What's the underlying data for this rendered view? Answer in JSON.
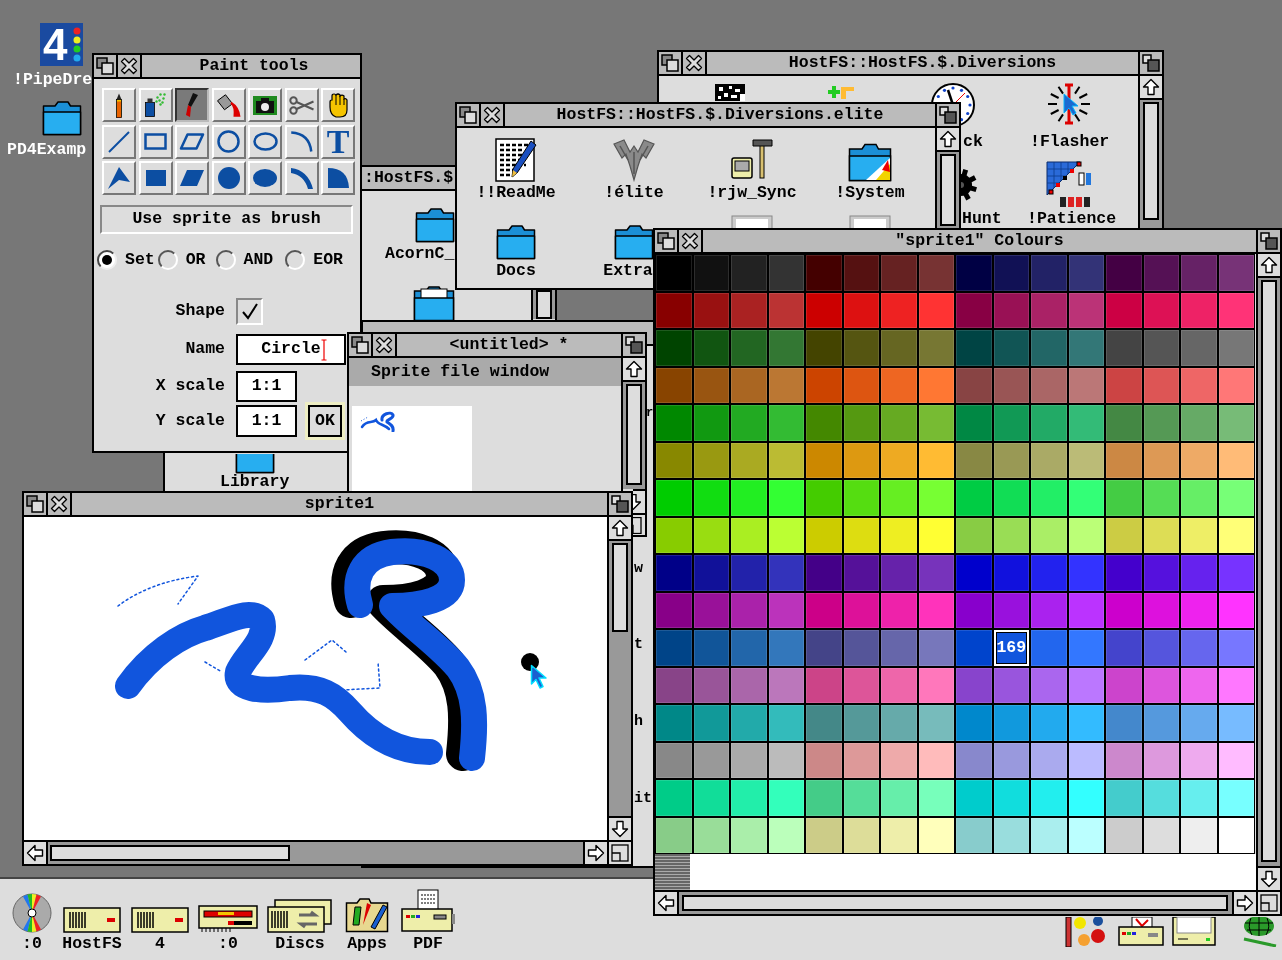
{
  "desktop_icons": [
    {
      "kind": "logo",
      "logo_text": "4",
      "label": "!PipeDre"
    },
    {
      "kind": "folder",
      "label": "PD4Examp"
    }
  ],
  "diversions_window": {
    "title": "HostFS::HostFS.$.Diversions",
    "items": [
      {
        "kind": "chequered"
      },
      {
        "kind": "blocks"
      },
      {
        "kind": "clock",
        "label": "ck"
      },
      {
        "kind": "flasher",
        "label": "!Flasher"
      },
      {
        "kind": "gear",
        "label": "Hunt"
      },
      {
        "kind": "patience",
        "label": "!Patience"
      }
    ]
  },
  "hostfs_window": {
    "title": ":HostFS.$",
    "items": [
      {
        "kind": "folder",
        "label": "AcornC_"
      },
      {
        "kind": "folder_doc"
      },
      {
        "kind": "folder",
        "label": "Library"
      }
    ]
  },
  "elite_window": {
    "title": "HostFS::HostFS.$.Diversions.elite",
    "items": [
      {
        "kind": "readme",
        "label": "!!ReadMe"
      },
      {
        "kind": "elite",
        "label": "!élite"
      },
      {
        "kind": "sync",
        "label": "!rjw_Sync"
      },
      {
        "kind": "system",
        "label": "!System"
      },
      {
        "kind": "folder",
        "label": "Docs"
      },
      {
        "kind": "folder",
        "label": "Extra"
      },
      {
        "kind": "file"
      },
      {
        "kind": "file"
      }
    ]
  },
  "paint_tools": {
    "title": "Paint tools",
    "tools": [
      {
        "kind": "pencil",
        "selected": false
      },
      {
        "kind": "spray",
        "selected": false
      },
      {
        "kind": "brush",
        "selected": true
      },
      {
        "kind": "fill",
        "selected": false
      },
      {
        "kind": "camera",
        "selected": false
      },
      {
        "kind": "scissors",
        "selected": false
      },
      {
        "kind": "hand",
        "selected": false
      },
      {
        "kind": "line",
        "selected": false
      },
      {
        "kind": "rectangle",
        "selected": false
      },
      {
        "kind": "parallelogram",
        "selected": false
      },
      {
        "kind": "circle",
        "selected": false
      },
      {
        "kind": "ellipse",
        "selected": false
      },
      {
        "kind": "arc",
        "selected": false
      },
      {
        "kind": "text",
        "glyph": "T",
        "selected": false
      },
      {
        "kind": "polygon",
        "selected": false
      },
      {
        "kind": "filled_rectangle",
        "selected": false
      },
      {
        "kind": "filled_parallelogram",
        "selected": false
      },
      {
        "kind": "filled_circle",
        "selected": false
      },
      {
        "kind": "filled_ellipse",
        "selected": false
      },
      {
        "kind": "segment",
        "selected": false
      },
      {
        "kind": "sector",
        "selected": false
      }
    ],
    "brush_label": "Use sprite as brush",
    "modes": [
      {
        "label": "Set",
        "selected": true
      },
      {
        "label": "OR",
        "selected": false
      },
      {
        "label": "AND",
        "selected": false
      },
      {
        "label": "EOR",
        "selected": false
      }
    ],
    "shape": {
      "label": "Shape",
      "checked": true
    },
    "fields": [
      {
        "label": "Name",
        "value": "Circle",
        "focused": true
      },
      {
        "label": "X scale",
        "value": "1:1",
        "focused": false
      },
      {
        "label": "Y scale",
        "value": "1:1",
        "focused": false
      }
    ],
    "ok_button": "OK"
  },
  "resources_window": {
    "icon_labels": [
      "r",
      "w",
      "t",
      "h",
      "it"
    ]
  },
  "untitled_window": {
    "title": "<untitled> *",
    "info_bar": "Sprite file window"
  },
  "sprite_window": {
    "title": "sprite1"
  },
  "colours_window": {
    "title": "\"sprite1\" Colours",
    "cells": [
      {
        "color": "#000000",
        "selected": false
      },
      {
        "color": "#111111",
        "selected": false
      },
      {
        "color": "#222222",
        "selected": false
      },
      {
        "color": "#333333",
        "selected": false
      },
      {
        "color": "#440000",
        "selected": false
      },
      {
        "color": "#551111",
        "selected": false
      },
      {
        "color": "#662222",
        "selected": false
      },
      {
        "color": "#773333",
        "selected": false
      },
      {
        "color": "#000044",
        "selected": false
      },
      {
        "color": "#111155",
        "selected": false
      },
      {
        "color": "#222266",
        "selected": false
      },
      {
        "color": "#333377",
        "selected": false
      },
      {
        "color": "#440044",
        "selected": false
      },
      {
        "color": "#551155",
        "selected": false
      },
      {
        "color": "#662266",
        "selected": false
      },
      {
        "color": "#773377",
        "selected": false
      },
      {
        "color": "#880000",
        "selected": false
      },
      {
        "color": "#991111",
        "selected": false
      },
      {
        "color": "#aa2222",
        "selected": false
      },
      {
        "color": "#bb3333",
        "selected": false
      },
      {
        "color": "#cc0000",
        "selected": false
      },
      {
        "color": "#dd1111",
        "selected": false
      },
      {
        "color": "#ee2222",
        "selected": false
      },
      {
        "color": "#ff3333",
        "selected": false
      },
      {
        "color": "#880044",
        "selected": false
      },
      {
        "color": "#991155",
        "selected": false
      },
      {
        "color": "#aa2266",
        "selected": false
      },
      {
        "color": "#bb3377",
        "selected": false
      },
      {
        "color": "#cc0044",
        "selected": false
      },
      {
        "color": "#dd1155",
        "selected": false
      },
      {
        "color": "#ee2266",
        "selected": false
      },
      {
        "color": "#ff3377",
        "selected": false
      },
      {
        "color": "#004400",
        "selected": false
      },
      {
        "color": "#115511",
        "selected": false
      },
      {
        "color": "#226622",
        "selected": false
      },
      {
        "color": "#337733",
        "selected": false
      },
      {
        "color": "#444400",
        "selected": false
      },
      {
        "color": "#555511",
        "selected": false
      },
      {
        "color": "#666622",
        "selected": false
      },
      {
        "color": "#777733",
        "selected": false
      },
      {
        "color": "#004444",
        "selected": false
      },
      {
        "color": "#115555",
        "selected": false
      },
      {
        "color": "#226666",
        "selected": false
      },
      {
        "color": "#337777",
        "selected": false
      },
      {
        "color": "#444444",
        "selected": false
      },
      {
        "color": "#555555",
        "selected": false
      },
      {
        "color": "#666666",
        "selected": false
      },
      {
        "color": "#777777",
        "selected": false
      },
      {
        "color": "#884400",
        "selected": false
      },
      {
        "color": "#995511",
        "selected": false
      },
      {
        "color": "#aa6622",
        "selected": false
      },
      {
        "color": "#bb7733",
        "selected": false
      },
      {
        "color": "#cc4400",
        "selected": false
      },
      {
        "color": "#dd5511",
        "selected": false
      },
      {
        "color": "#ee6622",
        "selected": false
      },
      {
        "color": "#ff7733",
        "selected": false
      },
      {
        "color": "#884444",
        "selected": false
      },
      {
        "color": "#995555",
        "selected": false
      },
      {
        "color": "#aa6666",
        "selected": false
      },
      {
        "color": "#bb7777",
        "selected": false
      },
      {
        "color": "#cc4444",
        "selected": false
      },
      {
        "color": "#dd5555",
        "selected": false
      },
      {
        "color": "#ee6666",
        "selected": false
      },
      {
        "color": "#ff7777",
        "selected": false
      },
      {
        "color": "#008800",
        "selected": false
      },
      {
        "color": "#119911",
        "selected": false
      },
      {
        "color": "#22aa22",
        "selected": false
      },
      {
        "color": "#33bb33",
        "selected": false
      },
      {
        "color": "#448800",
        "selected": false
      },
      {
        "color": "#559911",
        "selected": false
      },
      {
        "color": "#66aa22",
        "selected": false
      },
      {
        "color": "#77bb33",
        "selected": false
      },
      {
        "color": "#008844",
        "selected": false
      },
      {
        "color": "#119955",
        "selected": false
      },
      {
        "color": "#22aa66",
        "selected": false
      },
      {
        "color": "#33bb77",
        "selected": false
      },
      {
        "color": "#448844",
        "selected": false
      },
      {
        "color": "#559955",
        "selected": false
      },
      {
        "color": "#66aa66",
        "selected": false
      },
      {
        "color": "#77bb77",
        "selected": false
      },
      {
        "color": "#888800",
        "selected": false
      },
      {
        "color": "#999911",
        "selected": false
      },
      {
        "color": "#aaaa22",
        "selected": false
      },
      {
        "color": "#bbbb33",
        "selected": false
      },
      {
        "color": "#cc8800",
        "selected": false
      },
      {
        "color": "#dd9911",
        "selected": false
      },
      {
        "color": "#eeaa22",
        "selected": false
      },
      {
        "color": "#ffbb33",
        "selected": false
      },
      {
        "color": "#888844",
        "selected": false
      },
      {
        "color": "#999955",
        "selected": false
      },
      {
        "color": "#aaaa66",
        "selected": false
      },
      {
        "color": "#bbbb77",
        "selected": false
      },
      {
        "color": "#cc8844",
        "selected": false
      },
      {
        "color": "#dd9955",
        "selected": false
      },
      {
        "color": "#eeaa66",
        "selected": false
      },
      {
        "color": "#ffbb77",
        "selected": false
      },
      {
        "color": "#00cc00",
        "selected": false
      },
      {
        "color": "#11dd11",
        "selected": false
      },
      {
        "color": "#22ee22",
        "selected": false
      },
      {
        "color": "#33ff33",
        "selected": false
      },
      {
        "color": "#44cc00",
        "selected": false
      },
      {
        "color": "#55dd11",
        "selected": false
      },
      {
        "color": "#66ee22",
        "selected": false
      },
      {
        "color": "#77ff33",
        "selected": false
      },
      {
        "color": "#00cc44",
        "selected": false
      },
      {
        "color": "#11dd55",
        "selected": false
      },
      {
        "color": "#22ee66",
        "selected": false
      },
      {
        "color": "#33ff77",
        "selected": false
      },
      {
        "color": "#44cc44",
        "selected": false
      },
      {
        "color": "#55dd55",
        "selected": false
      },
      {
        "color": "#66ee66",
        "selected": false
      },
      {
        "color": "#77ff77",
        "selected": false
      },
      {
        "color": "#88cc00",
        "selected": false
      },
      {
        "color": "#99dd11",
        "selected": false
      },
      {
        "color": "#aaee22",
        "selected": false
      },
      {
        "color": "#bbff33",
        "selected": false
      },
      {
        "color": "#cccc00",
        "selected": false
      },
      {
        "color": "#dddd11",
        "selected": false
      },
      {
        "color": "#eeee22",
        "selected": false
      },
      {
        "color": "#ffff33",
        "selected": false
      },
      {
        "color": "#88cc44",
        "selected": false
      },
      {
        "color": "#99dd55",
        "selected": false
      },
      {
        "color": "#aaee66",
        "selected": false
      },
      {
        "color": "#bbff77",
        "selected": false
      },
      {
        "color": "#cccc44",
        "selected": false
      },
      {
        "color": "#dddd55",
        "selected": false
      },
      {
        "color": "#eeee66",
        "selected": false
      },
      {
        "color": "#ffff77",
        "selected": false
      },
      {
        "color": "#000088",
        "selected": false
      },
      {
        "color": "#111199",
        "selected": false
      },
      {
        "color": "#2222aa",
        "selected": false
      },
      {
        "color": "#3333bb",
        "selected": false
      },
      {
        "color": "#440088",
        "selected": false
      },
      {
        "color": "#551199",
        "selected": false
      },
      {
        "color": "#6622aa",
        "selected": false
      },
      {
        "color": "#7733bb",
        "selected": false
      },
      {
        "color": "#0000cc",
        "selected": false
      },
      {
        "color": "#1111dd",
        "selected": false
      },
      {
        "color": "#2222ee",
        "selected": false
      },
      {
        "color": "#3333ff",
        "selected": false
      },
      {
        "color": "#4400cc",
        "selected": false
      },
      {
        "color": "#5511dd",
        "selected": false
      },
      {
        "color": "#6622ee",
        "selected": false
      },
      {
        "color": "#7733ff",
        "selected": false
      },
      {
        "color": "#880088",
        "selected": false
      },
      {
        "color": "#991199",
        "selected": false
      },
      {
        "color": "#aa22aa",
        "selected": false
      },
      {
        "color": "#bb33bb",
        "selected": false
      },
      {
        "color": "#cc0088",
        "selected": false
      },
      {
        "color": "#dd1199",
        "selected": false
      },
      {
        "color": "#ee22aa",
        "selected": false
      },
      {
        "color": "#ff33bb",
        "selected": false
      },
      {
        "color": "#8800cc",
        "selected": false
      },
      {
        "color": "#9911dd",
        "selected": false
      },
      {
        "color": "#aa22ee",
        "selected": false
      },
      {
        "color": "#bb33ff",
        "selected": false
      },
      {
        "color": "#cc00cc",
        "selected": false
      },
      {
        "color": "#dd11dd",
        "selected": false
      },
      {
        "color": "#ee22ee",
        "selected": false
      },
      {
        "color": "#ff33ff",
        "selected": false
      },
      {
        "color": "#004488",
        "selected": false
      },
      {
        "color": "#115599",
        "selected": false
      },
      {
        "color": "#2266aa",
        "selected": false
      },
      {
        "color": "#3377bb",
        "selected": false
      },
      {
        "color": "#444488",
        "selected": false
      },
      {
        "color": "#555599",
        "selected": false
      },
      {
        "color": "#6666aa",
        "selected": false
      },
      {
        "color": "#7777bb",
        "selected": false
      },
      {
        "color": "#0044cc",
        "selected": false
      },
      {
        "color": "#1155dd",
        "selected": true,
        "label": "169"
      },
      {
        "color": "#2266ee",
        "selected": false
      },
      {
        "color": "#3377ff",
        "selected": false
      },
      {
        "color": "#4444cc",
        "selected": false
      },
      {
        "color": "#5555dd",
        "selected": false
      },
      {
        "color": "#6666ee",
        "selected": false
      },
      {
        "color": "#7777ff",
        "selected": false
      },
      {
        "color": "#884488",
        "selected": false
      },
      {
        "color": "#995599",
        "selected": false
      },
      {
        "color": "#aa66aa",
        "selected": false
      },
      {
        "color": "#bb77bb",
        "selected": false
      },
      {
        "color": "#cc4488",
        "selected": false
      },
      {
        "color": "#dd5599",
        "selected": false
      },
      {
        "color": "#ee66aa",
        "selected": false
      },
      {
        "color": "#ff77bb",
        "selected": false
      },
      {
        "color": "#8844cc",
        "selected": false
      },
      {
        "color": "#9955dd",
        "selected": false
      },
      {
        "color": "#aa66ee",
        "selected": false
      },
      {
        "color": "#bb77ff",
        "selected": false
      },
      {
        "color": "#cc44cc",
        "selected": false
      },
      {
        "color": "#dd55dd",
        "selected": false
      },
      {
        "color": "#ee66ee",
        "selected": false
      },
      {
        "color": "#ff77ff",
        "selected": false
      },
      {
        "color": "#008888",
        "selected": false
      },
      {
        "color": "#119999",
        "selected": false
      },
      {
        "color": "#22aaaa",
        "selected": false
      },
      {
        "color": "#33bbbb",
        "selected": false
      },
      {
        "color": "#448888",
        "selected": false
      },
      {
        "color": "#559999",
        "selected": false
      },
      {
        "color": "#66aaaa",
        "selected": false
      },
      {
        "color": "#77bbbb",
        "selected": false
      },
      {
        "color": "#0088cc",
        "selected": false
      },
      {
        "color": "#1199dd",
        "selected": false
      },
      {
        "color": "#22aaee",
        "selected": false
      },
      {
        "color": "#33bbff",
        "selected": false
      },
      {
        "color": "#4488cc",
        "selected": false
      },
      {
        "color": "#5599dd",
        "selected": false
      },
      {
        "color": "#66aaee",
        "selected": false
      },
      {
        "color": "#77bbff",
        "selected": false
      },
      {
        "color": "#888888",
        "selected": false
      },
      {
        "color": "#999999",
        "selected": false
      },
      {
        "color": "#aaaaaa",
        "selected": false
      },
      {
        "color": "#bbbbbb",
        "selected": false
      },
      {
        "color": "#cc8888",
        "selected": false
      },
      {
        "color": "#dd9999",
        "selected": false
      },
      {
        "color": "#eeaaaa",
        "selected": false
      },
      {
        "color": "#ffbbbb",
        "selected": false
      },
      {
        "color": "#8888cc",
        "selected": false
      },
      {
        "color": "#9999dd",
        "selected": false
      },
      {
        "color": "#aaaaee",
        "selected": false
      },
      {
        "color": "#bbbbff",
        "selected": false
      },
      {
        "color": "#cc88cc",
        "selected": false
      },
      {
        "color": "#dd99dd",
        "selected": false
      },
      {
        "color": "#eeaaee",
        "selected": false
      },
      {
        "color": "#ffbbff",
        "selected": false
      },
      {
        "color": "#00cc88",
        "selected": false
      },
      {
        "color": "#11dd99",
        "selected": false
      },
      {
        "color": "#22eeaa",
        "selected": false
      },
      {
        "color": "#33ffbb",
        "selected": false
      },
      {
        "color": "#44cc88",
        "selected": false
      },
      {
        "color": "#55dd99",
        "selected": false
      },
      {
        "color": "#66eeaa",
        "selected": false
      },
      {
        "color": "#77ffbb",
        "selected": false
      },
      {
        "color": "#00cccc",
        "selected": false
      },
      {
        "color": "#11dddd",
        "selected": false
      },
      {
        "color": "#22eeee",
        "selected": false
      },
      {
        "color": "#33ffff",
        "selected": false
      },
      {
        "color": "#44cccc",
        "selected": false
      },
      {
        "color": "#55dddd",
        "selected": false
      },
      {
        "color": "#66eeee",
        "selected": false
      },
      {
        "color": "#77ffff",
        "selected": false
      },
      {
        "color": "#88cc88",
        "selected": false
      },
      {
        "color": "#99dd99",
        "selected": false
      },
      {
        "color": "#aaeeaa",
        "selected": false
      },
      {
        "color": "#bbffbb",
        "selected": false
      },
      {
        "color": "#cccc88",
        "selected": false
      },
      {
        "color": "#dddd99",
        "selected": false
      },
      {
        "color": "#eeeeaa",
        "selected": false
      },
      {
        "color": "#ffffbb",
        "selected": false
      },
      {
        "color": "#88cccc",
        "selected": false
      },
      {
        "color": "#99dddd",
        "selected": false
      },
      {
        "color": "#aaeeee",
        "selected": false
      },
      {
        "color": "#bbffff",
        "selected": false
      },
      {
        "color": "#cccccc",
        "selected": false
      },
      {
        "color": "#dddddd",
        "selected": false
      },
      {
        "color": "#eeeeee",
        "selected": false
      },
      {
        "color": "#ffffff",
        "selected": false
      }
    ]
  },
  "icon_bar": {
    "left": [
      {
        "kind": "cd",
        "label": ":0"
      },
      {
        "kind": "drive",
        "label": "HostFS"
      },
      {
        "kind": "drive",
        "label": "4"
      },
      {
        "kind": "floppy",
        "label": ":0"
      },
      {
        "kind": "discs",
        "label": "Discs"
      },
      {
        "kind": "apps",
        "label": "Apps"
      },
      {
        "kind": "printer",
        "label": "PDF"
      }
    ],
    "right": [
      {
        "kind": "paint"
      },
      {
        "kind": "pdf_printer"
      },
      {
        "kind": "computer"
      },
      {
        "kind": "globe"
      }
    ]
  }
}
